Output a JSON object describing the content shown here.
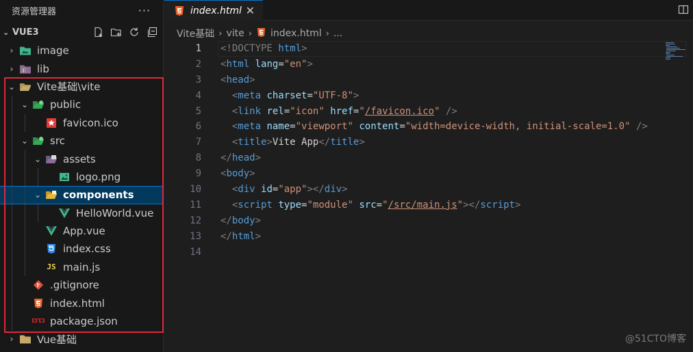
{
  "explorer": {
    "title": "资源管理器",
    "more_icon": "ellipsis-icon",
    "section": "VUE3",
    "actions": [
      "new-file-icon",
      "new-folder-icon",
      "refresh-icon",
      "collapse-all-icon"
    ]
  },
  "tree": [
    {
      "label": "image",
      "icon": "image-folder-icon",
      "depth": 0,
      "twistie": "›",
      "color": "#3fb68b"
    },
    {
      "label": "lib",
      "icon": "lib-folder-icon",
      "depth": 0,
      "twistie": "›",
      "color": "#c75b8b"
    },
    {
      "label": "Vite基础\\vite",
      "icon": "folder-open-icon",
      "depth": 0,
      "twistie": "⌄",
      "color": "#d6c08b"
    },
    {
      "label": "public",
      "icon": "public-folder-icon",
      "depth": 1,
      "twistie": "⌄",
      "color": "#34a853"
    },
    {
      "label": "favicon.ico",
      "icon": "favicon-icon",
      "depth": 2,
      "twistie": "",
      "color": "#e53935"
    },
    {
      "label": "src",
      "icon": "src-folder-icon",
      "depth": 1,
      "twistie": "⌄",
      "color": "#34a853"
    },
    {
      "label": "assets",
      "icon": "assets-folder-icon",
      "depth": 2,
      "twistie": "⌄",
      "color": "#8b6b9b"
    },
    {
      "label": "logo.png",
      "icon": "image-file-icon",
      "depth": 3,
      "twistie": "",
      "color": "#3fb68b"
    },
    {
      "label": "components",
      "icon": "components-folder-icon",
      "depth": 2,
      "twistie": "⌄",
      "color": "#e8b43a",
      "selected": true
    },
    {
      "label": "HelloWorld.vue",
      "icon": "vue-icon",
      "depth": 3,
      "twistie": "",
      "color": "#41b883"
    },
    {
      "label": "App.vue",
      "icon": "vue-icon",
      "depth": 2,
      "twistie": "",
      "color": "#41b883"
    },
    {
      "label": "index.css",
      "icon": "css-icon",
      "depth": 2,
      "twistie": "",
      "color": "#2f8be6"
    },
    {
      "label": "main.js",
      "icon": "js-icon",
      "depth": 2,
      "twistie": "",
      "color": "#e8d44d"
    },
    {
      "label": ".gitignore",
      "icon": "git-icon",
      "depth": 1,
      "twistie": "",
      "color": "#e0523b"
    },
    {
      "label": "index.html",
      "icon": "html-icon",
      "depth": 1,
      "twistie": "",
      "color": "#e96228"
    },
    {
      "label": "package.json",
      "icon": "npm-icon",
      "depth": 1,
      "twistie": "",
      "color": "#c12127"
    },
    {
      "label": "Vue基础",
      "icon": "folder-icon",
      "depth": 0,
      "twistie": "›",
      "color": "#d6c08b"
    }
  ],
  "tab": {
    "label": "index.html",
    "icon": "html-icon",
    "close": "✕"
  },
  "split_icon": "split-editor-icon",
  "breadcrumbs": [
    "Vite基础",
    "vite",
    "index.html",
    "..."
  ],
  "line_numbers": [
    "1",
    "2",
    "3",
    "4",
    "5",
    "6",
    "7",
    "8",
    "9",
    "10",
    "11",
    "12",
    "13",
    "14"
  ],
  "code": {
    "l1": [
      "<!DOCTYPE ",
      "html",
      ">"
    ],
    "l2": [
      "<",
      "html",
      " ",
      "lang",
      "=",
      "\"en\"",
      ">"
    ],
    "l3": [
      "<",
      "head",
      ">"
    ],
    "l4": [
      "  <",
      "meta",
      " ",
      "charset",
      "=",
      "\"UTF-8\"",
      ">"
    ],
    "l5": [
      "  <",
      "link",
      " ",
      "rel",
      "=",
      "\"icon\"",
      " ",
      "href",
      "=",
      "\"",
      "/favicon.ico",
      "\"",
      " />"
    ],
    "l6": [
      "  <",
      "meta",
      " ",
      "name",
      "=",
      "\"viewport\"",
      " ",
      "content",
      "=",
      "\"width=device-width, initial-scale=1.0\"",
      " />"
    ],
    "l7": [
      "  <",
      "title",
      ">",
      "Vite App",
      "</",
      "title",
      ">"
    ],
    "l8": [
      "</",
      "head",
      ">"
    ],
    "l9": [
      "<",
      "body",
      ">"
    ],
    "l10": [
      "  <",
      "div",
      " ",
      "id",
      "=",
      "\"app\"",
      "></",
      "div",
      ">"
    ],
    "l11": [
      "  <",
      "script",
      " ",
      "type",
      "=",
      "\"module\"",
      " ",
      "src",
      "=",
      "\"",
      "/src/main.js",
      "\"",
      "></",
      "script",
      ">"
    ],
    "l12": [
      "</",
      "body",
      ">"
    ],
    "l13": [
      "</",
      "html",
      ">"
    ]
  },
  "watermark": "@51CTO博客"
}
